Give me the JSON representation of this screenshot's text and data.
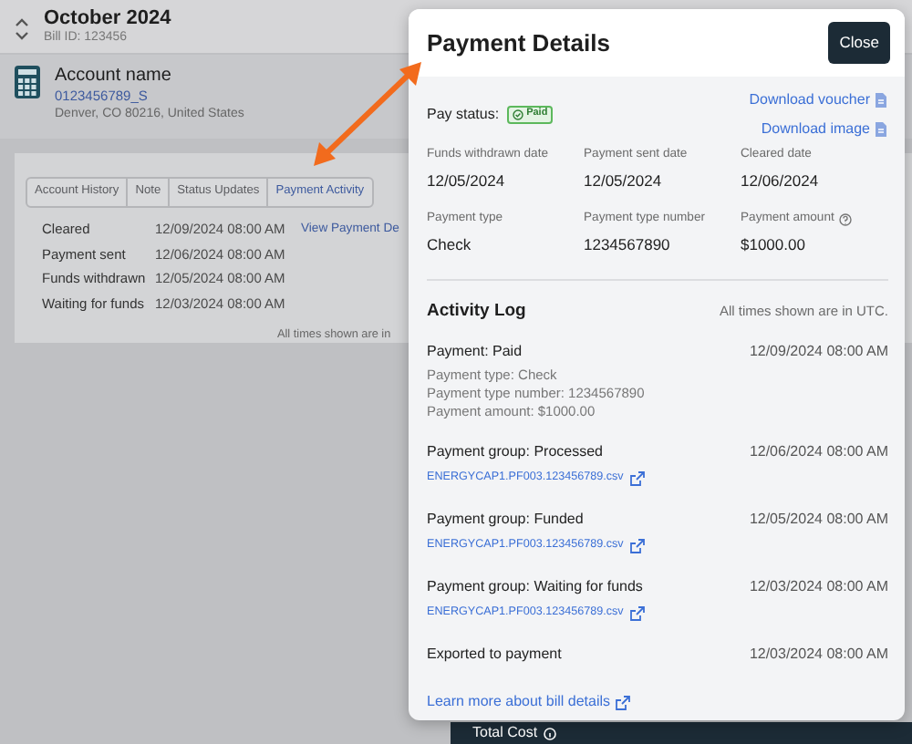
{
  "header": {
    "title": "October 2024",
    "bill_id": "Bill ID: 123456"
  },
  "account": {
    "name": "Account name",
    "number": "0123456789_S",
    "address": "Denver, CO 80216, United States"
  },
  "tabs": [
    {
      "label": "Account History",
      "selected": false
    },
    {
      "label": "Note",
      "selected": false
    },
    {
      "label": "Status Updates",
      "selected": false
    },
    {
      "label": "Payment Activity",
      "selected": true
    }
  ],
  "activity_rows": [
    {
      "status": "Cleared",
      "time": "12/09/2024 08:00 AM",
      "link": "View Payment De"
    },
    {
      "status": "Payment sent",
      "time": "12/06/2024 08:00 AM"
    },
    {
      "status": "Funds withdrawn",
      "time": "12/05/2024 08:00 AM"
    },
    {
      "status": "Waiting for funds",
      "time": "12/03/2024 08:00 AM"
    }
  ],
  "footnote": "All times shown are in",
  "footer_bar": {
    "label": "Total Cost"
  },
  "modal": {
    "title": "Payment Details",
    "close": "Close",
    "pay_status_label": "Pay status:",
    "pay_status": {
      "label": "Paid",
      "kind": "paid"
    },
    "links": [
      "Download voucher",
      "Download image"
    ],
    "fields": [
      {
        "label": "Funds withdrawn date",
        "value": "12/05/2024"
      },
      {
        "label": "Payment sent date",
        "value": "12/05/2024"
      },
      {
        "label": "Cleared date",
        "value": "12/06/2024"
      },
      {
        "label": "Payment type",
        "value": "Check"
      },
      {
        "label": "Payment type number",
        "value": "1234567890"
      },
      {
        "label": "Payment amount",
        "value": "$1000.00",
        "help": true
      }
    ],
    "activity_log": {
      "title": "Activity Log",
      "note": "All times shown are in UTC.",
      "entries": [
        {
          "title": "Payment: Paid",
          "time": "12/09/2024 08:00 AM",
          "details": [
            "Payment type: Check",
            "Payment type number: 1234567890",
            "Payment amount: $1000.00"
          ]
        },
        {
          "title": "Payment group: Processed",
          "time": "12/06/2024 08:00 AM",
          "file": "ENERGYCAP1.PF003.123456789.csv"
        },
        {
          "title": "Payment group: Funded",
          "time": "12/05/2024 08:00 AM",
          "file": "ENERGYCAP1.PF003.123456789.csv"
        },
        {
          "title": "Payment group: Waiting for funds",
          "time": "12/03/2024 08:00 AM",
          "file": "ENERGYCAP1.PF003.123456789.csv"
        },
        {
          "title": "Exported to payment",
          "time": "12/03/2024 08:00 AM"
        }
      ]
    },
    "learn_more": "Learn more about bill details"
  }
}
